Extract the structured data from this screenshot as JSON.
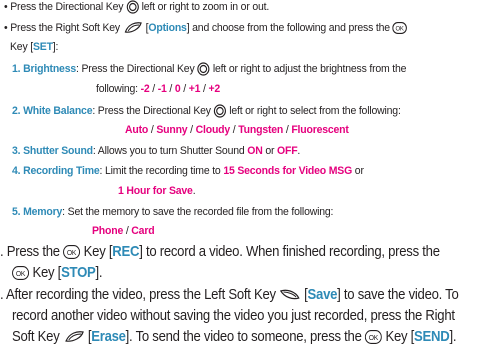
{
  "l1": {
    "a": "• Press the Directional Key ",
    "b": " left or right to zoom in or out."
  },
  "l2": {
    "a": "• Press the Right Soft Key ",
    "open": " [",
    "opt": "Options",
    "b": "] and choose from the following and press the "
  },
  "l3": {
    "a": "Key [",
    "set": "SET",
    "b": "]:"
  },
  "l4": {
    "n": "1. Brightness",
    "a": ": Press the Directional Key ",
    "b": " left or right to adjust the brightness from the"
  },
  "l5": {
    "a": "following: ",
    "v": [
      "-2",
      "-1",
      "0",
      "+1",
      "+2"
    ],
    "sep": " / "
  },
  "l6": {
    "n": "2. White Balance",
    "a": ": Press the Directional Key ",
    "b": " left or right to select from the following:"
  },
  "l7": {
    "v": [
      "Auto",
      "Sunny",
      "Cloudy",
      "Tungsten",
      "Fluorescent"
    ],
    "sep": " / "
  },
  "l8": {
    "n": "3. Shutter Sound",
    "a": ": Allows you to turn Shutter Sound ",
    "on": "ON",
    "or": " or ",
    "off": "OFF",
    "end": "."
  },
  "l9": {
    "n": "4. Recording Time",
    "a": ": Limit the recording time to ",
    "v": "15 Seconds for Video MSG",
    "b": " or"
  },
  "l10": {
    "v": "1 Hour for Save",
    "end": "."
  },
  "l11": {
    "n": "5. Memory",
    "a": ": Set the memory to save the recorded file from the following:"
  },
  "l12": {
    "v": [
      "Phone",
      "Card"
    ],
    "sep": " / "
  },
  "l13": {
    "a": ". Press the ",
    "b": " Key [",
    "rec": "REC",
    "c": "] to record a video. When finished recording, press the"
  },
  "l14": {
    "a": " Key [",
    "stop": "STOP",
    "b": "]."
  },
  "l15": {
    "a": ". After recording the video, press the Left Soft Key ",
    "b": " [",
    "save": "Save",
    "c": "] to save the video. To"
  },
  "l16": {
    "a": "record another video without saving the video you just recorded, press the Right"
  },
  "l17": {
    "a": "Soft Key ",
    "b": " [",
    "erase": "Erase",
    "c": "]. To send the video to someone, press the ",
    "d": " Key [",
    "send": "SEND",
    "e": "]."
  },
  "icons": {
    "ok": "OK",
    "dir": "directional-key-icon",
    "rsoft": "right-soft-key-icon",
    "lsoft": "left-soft-key-icon"
  }
}
